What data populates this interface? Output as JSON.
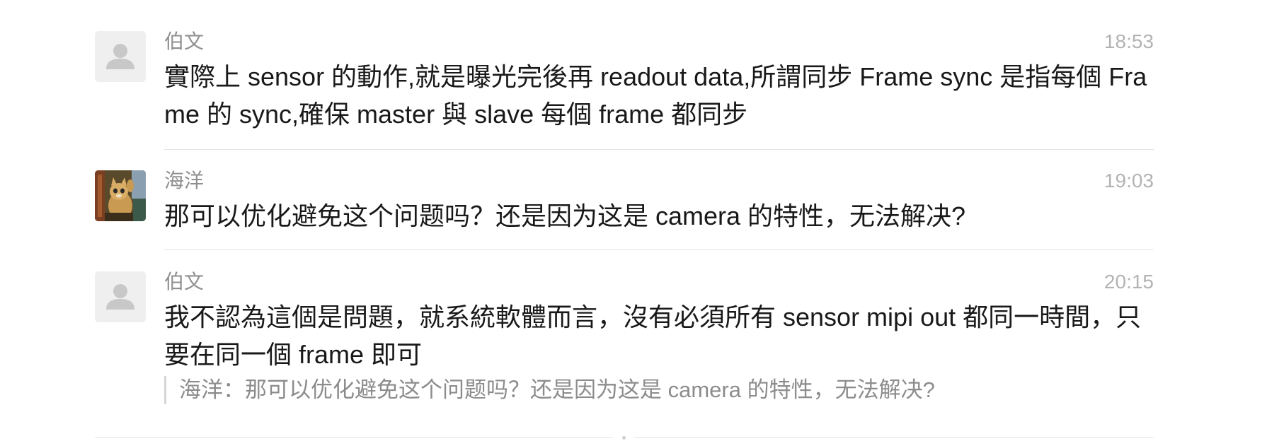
{
  "messages": [
    {
      "sender": "伯文",
      "time": "18:53",
      "avatar_icon": "default-user-icon",
      "text": "實際上 sensor 的動作,就是曝光完後再 readout data,所謂同步 Frame sync 是指每個 Frame 的 sync,確保 master 與 slave 每個 frame 都同步"
    },
    {
      "sender": "海洋",
      "time": "19:03",
      "avatar_icon": "cat-photo-avatar",
      "text": "那可以优化避免这个问题吗？还是因为这是 camera 的特性，无法解决?"
    },
    {
      "sender": "伯文",
      "time": "20:15",
      "avatar_icon": "default-user-icon",
      "text": "我不認為這個是問題，就系統軟體而言，沒有必須所有 sensor mipi out 都同一時間，只要在同一個 frame 即可",
      "quote": "海洋：那可以优化避免这个问题吗？还是因为这是 camera 的特性，无法解决?"
    }
  ],
  "colors": {
    "sender": "#8f8f8f",
    "time": "#b3b3b3",
    "body_text": "#191919",
    "quote_text": "#8c8c8c",
    "divider": "#e3e3e3",
    "default_avatar_bg": "#efefef",
    "default_avatar_glyph": "#c8c8c8"
  }
}
